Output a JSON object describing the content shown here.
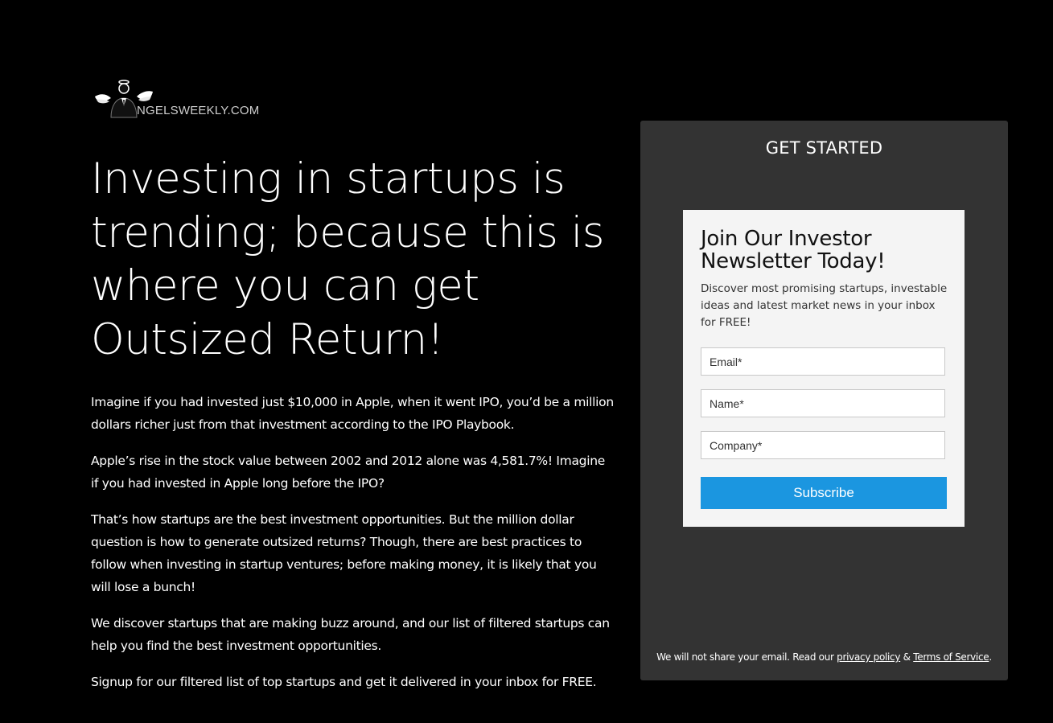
{
  "brand": {
    "logo_text": "NGELSWEEKLY.COM"
  },
  "hero": {
    "headline": "Investing in startups is trending; because this is where you can get Outsized Return!",
    "paragraphs": [
      "Imagine if you had invested just $10,000 in Apple, when it went IPO, you’d be a million dollars richer just from that investment according to the IPO Playbook.",
      "Apple’s rise in the stock value between 2002 and 2012 alone was 4,581.7%! Imagine if you had invested in Apple long before the IPO?",
      "That’s how startups are the best investment opportunities. But the million dollar question is how to generate outsized returns? Though, there are best practices to follow when investing in startup ventures; before making money, it is likely that you will lose a bunch!",
      "We discover startups that are making buzz around, and our list of filtered startups can help you find the best investment opportunities.",
      "Signup for our filtered list of top startups and get it delivered in your inbox for FREE."
    ]
  },
  "panel": {
    "title": "GET STARTED",
    "form": {
      "heading": "Join Our Investor Newsletter Today!",
      "description": "Discover most promising startups, investable ideas and latest market news in your inbox for FREE!",
      "email_placeholder": "Email*",
      "name_placeholder": "Name*",
      "company_placeholder": "Company*",
      "subscribe_label": "Subscribe"
    },
    "disclaimer": {
      "prefix": "We will not share your email. Read our ",
      "privacy_link": "privacy policy",
      "separator": " & ",
      "terms_link": "Terms of Service",
      "suffix": "."
    }
  },
  "colors": {
    "background": "#000000",
    "panel": "#333333",
    "card": "#f4f4f4",
    "button": "#1b96e0"
  }
}
